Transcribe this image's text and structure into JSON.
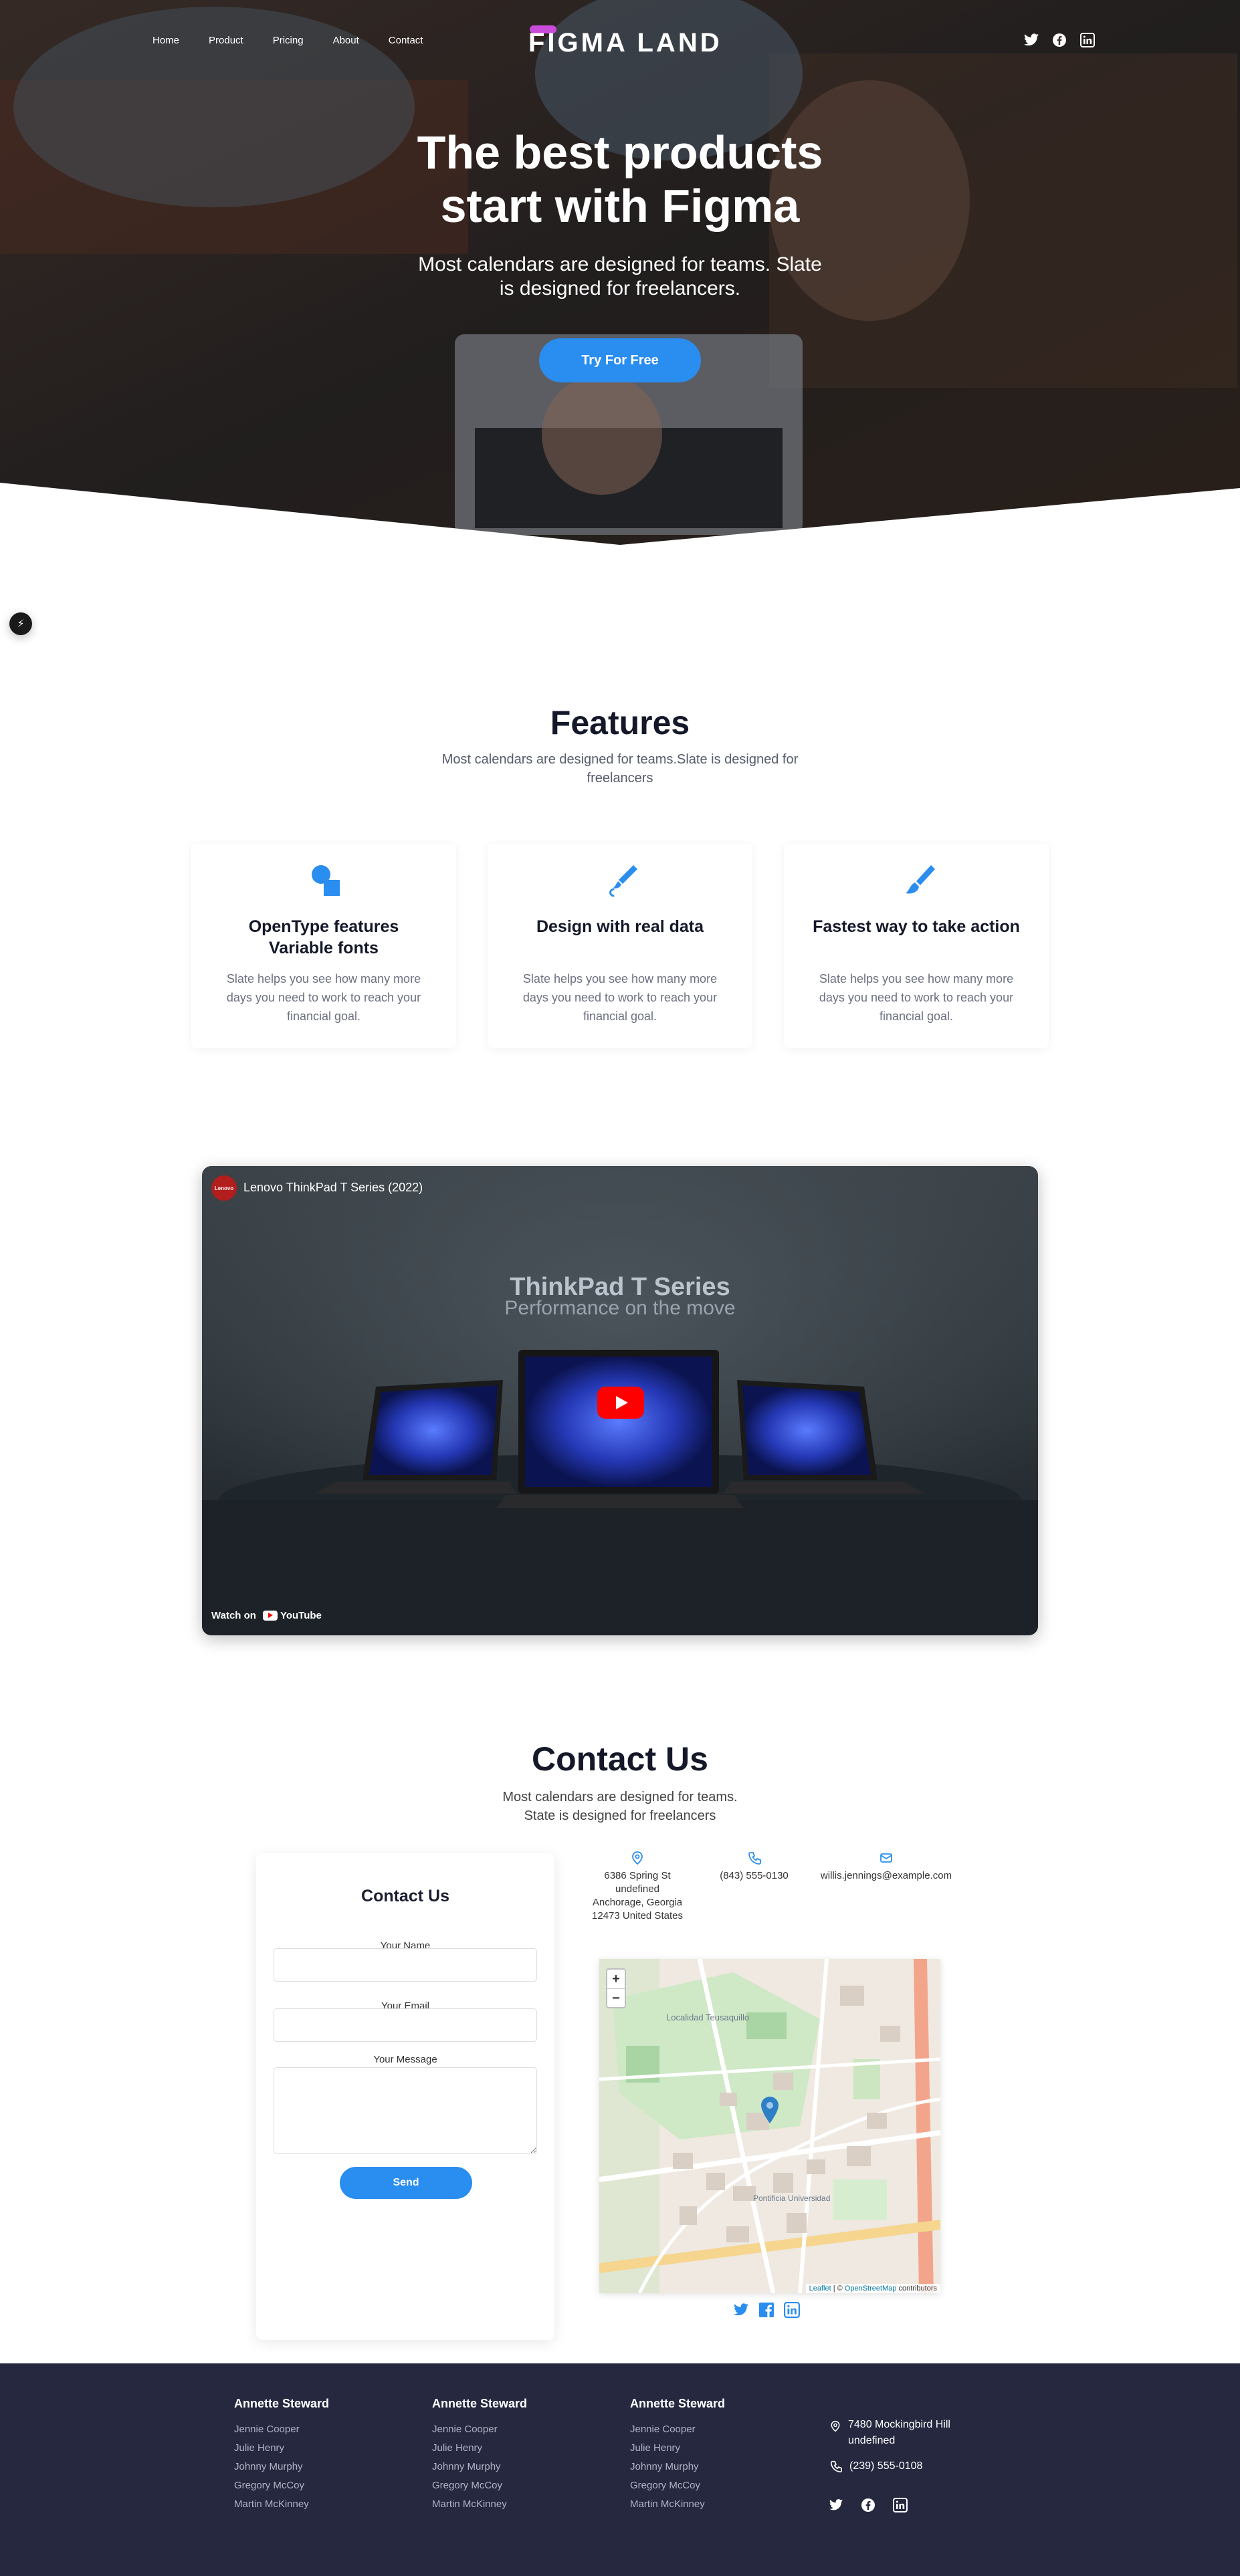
{
  "nav": {
    "items": [
      "Home",
      "Product",
      "Pricing",
      "About",
      "Contact"
    ]
  },
  "logo": "FIGMA LAND",
  "hero": {
    "title_line1": "The best products",
    "title_line2": "start with Figma",
    "subtitle_line1": "Most calendars are designed for teams. Slate",
    "subtitle_line2": "is designed for freelancers.",
    "cta": "Try For Free"
  },
  "features": {
    "title": "Features",
    "subtitle": "Most calendars are designed for teams.Slate is designed for freelancers",
    "cards": [
      {
        "icon": "shapes-icon",
        "title": "OpenType features Variable fonts",
        "desc": "Slate helps you see how many more days you need to work to reach your financial goal."
      },
      {
        "icon": "pen-icon",
        "title": "Design with real data",
        "desc": "Slate helps you see how many more days you need to work to reach your financial goal."
      },
      {
        "icon": "brush-icon",
        "title": "Fastest way to take action",
        "desc": "Slate helps you see how many more days you need to work to reach your financial goal."
      }
    ]
  },
  "video": {
    "channel": "Lenovo",
    "title": "Lenovo ThinkPad T Series (2022)",
    "heading": "ThinkPad T Series",
    "subheading": "Performance on the move",
    "watch_on": "Watch on",
    "platform": "YouTube"
  },
  "contact": {
    "title": "Contact Us",
    "subtitle_line1": "Most calendars are designed for teams.",
    "subtitle_line2": "State is designed for freelancers",
    "form": {
      "title": "Contact Us",
      "name_label": "Your Name",
      "email_label": "Your Email",
      "message_label": "Your Message",
      "send": "Send"
    },
    "address_lines": [
      "6386 Spring St",
      "undefined",
      "Anchorage, Georgia",
      "12473 United States"
    ],
    "phone": "(843) 555-0130",
    "email": "willis.jennings@example.com",
    "map": {
      "zoom_in": "+",
      "zoom_out": "−",
      "place_label": "Localidad Teusaquillo",
      "place_label2": "Pontificia Universidad",
      "attribution_leaflet": "Leaflet",
      "attribution_sep": " | © ",
      "attribution_osm": "OpenStreetMap",
      "attribution_tail": " contributors"
    }
  },
  "footer": {
    "columns": [
      {
        "title": "Annette Steward",
        "items": [
          "Jennie Cooper",
          "Julie Henry",
          "Johnny Murphy",
          "Gregory McCoy",
          "Martin McKinney"
        ]
      },
      {
        "title": "Annette Steward",
        "items": [
          "Jennie Cooper",
          "Julie Henry",
          "Johnny Murphy",
          "Gregory McCoy",
          "Martin McKinney"
        ]
      },
      {
        "title": "Annette Steward",
        "items": [
          "Jennie Cooper",
          "Julie Henry",
          "Johnny Murphy",
          "Gregory McCoy",
          "Martin McKinney"
        ]
      }
    ],
    "address_line1": "7480 Mockingbird Hill",
    "address_line2": "undefined",
    "phone": "(239) 555-0108"
  },
  "colors": {
    "accent": "#2a8df0",
    "footer_bg": "#25283f",
    "logo_bar": "#c94bd9"
  }
}
